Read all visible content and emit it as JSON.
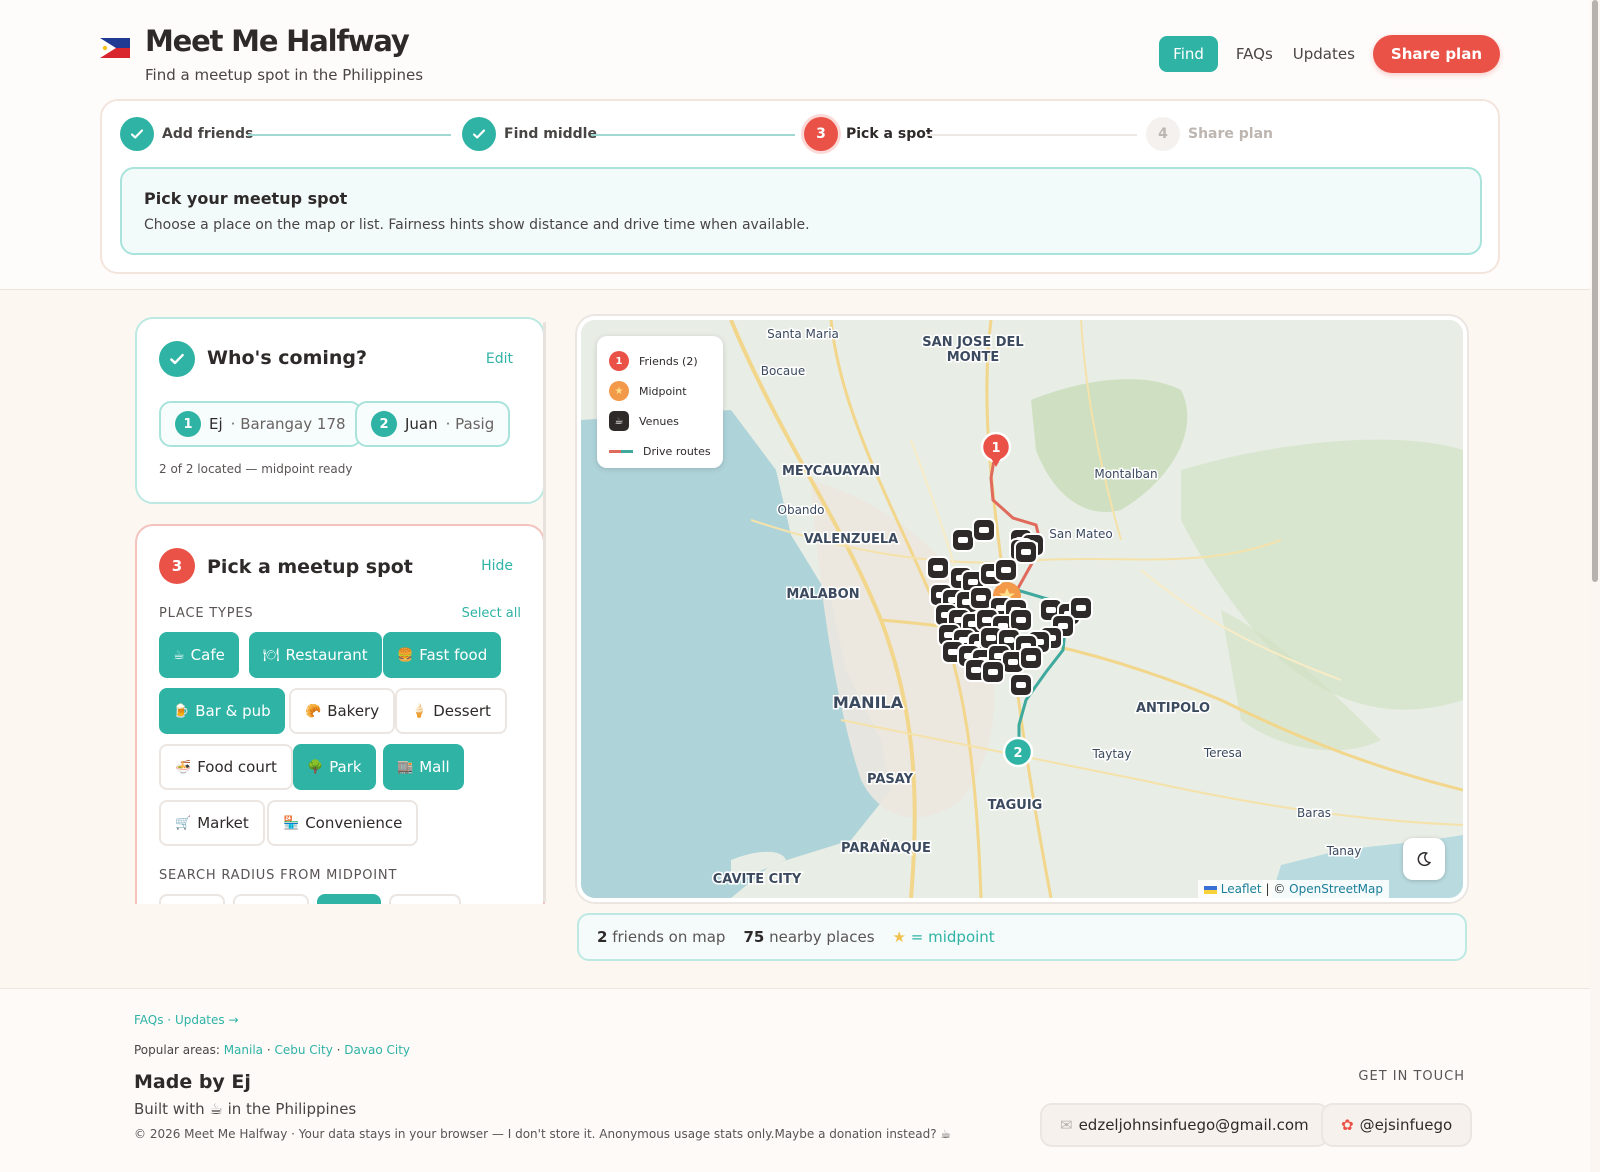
{
  "header": {
    "title": "Meet Me Halfway",
    "subtitle": "Find a meetup spot in the Philippines",
    "nav": {
      "find": "Find",
      "faqs": "FAQs",
      "updates": "Updates",
      "share": "Share plan"
    }
  },
  "stepper": {
    "steps": [
      {
        "num": "1",
        "label": "Add friends",
        "state": "done"
      },
      {
        "num": "2",
        "label": "Find middle",
        "state": "done"
      },
      {
        "num": "3",
        "label": "Pick a spot",
        "state": "active"
      },
      {
        "num": "4",
        "label": "Share plan",
        "state": "todo"
      }
    ],
    "info_title": "Pick your meetup spot",
    "info_text": "Choose a place on the map or list. Fairness hints show distance and drive time when available."
  },
  "who": {
    "title": "Who's coming?",
    "edit": "Edit",
    "friends": [
      {
        "num": "1",
        "name": "Ej",
        "place": "· Barangay 178"
      },
      {
        "num": "2",
        "name": "Juan",
        "place": "· Pasig"
      }
    ],
    "status": "2 of 2 located — midpoint ready"
  },
  "pick": {
    "num": "3",
    "title": "Pick a meetup spot",
    "hide": "Hide",
    "types_label": "PLACE TYPES",
    "select_all": "Select all",
    "types": [
      {
        "label": "Cafe",
        "icon": "☕",
        "on": true
      },
      {
        "label": "Restaurant",
        "icon": "🍽",
        "on": true
      },
      {
        "label": "Fast food",
        "icon": "🍔",
        "on": true
      },
      {
        "label": "Bar & pub",
        "icon": "🍺",
        "on": true
      },
      {
        "label": "Bakery",
        "icon": "🥐",
        "on": false
      },
      {
        "label": "Dessert",
        "icon": "🍦",
        "on": false
      },
      {
        "label": "Food court",
        "icon": "🍜",
        "on": false
      },
      {
        "label": "Park",
        "icon": "🌳",
        "on": true
      },
      {
        "label": "Mall",
        "icon": "🏬",
        "on": true
      },
      {
        "label": "Market",
        "icon": "🛒",
        "on": false
      },
      {
        "label": "Convenience",
        "icon": "🏪",
        "on": false
      }
    ],
    "radius_label": "SEARCH RADIUS FROM MIDPOINT"
  },
  "map": {
    "legend": {
      "friends": "Friends (2)",
      "midpoint": "Midpoint",
      "venues": "Venues",
      "routes": "Drive routes"
    },
    "labels": [
      {
        "text": "Santa Maria"
      },
      {
        "text": "SAN JOSE DEL"
      },
      {
        "text": "MONTE"
      },
      {
        "text": "Bocaue"
      },
      {
        "text": "MEYCAUAYAN"
      },
      {
        "text": "Montalban"
      },
      {
        "text": "Obando"
      },
      {
        "text": "VALENZUELA"
      },
      {
        "text": "San Mateo"
      },
      {
        "text": "MALABON"
      },
      {
        "text": "MANILA"
      },
      {
        "text": "ANTIPOLO"
      },
      {
        "text": "Taytay"
      },
      {
        "text": "Teresa"
      },
      {
        "text": "PASAY"
      },
      {
        "text": "TAGUIG"
      },
      {
        "text": "Baras"
      },
      {
        "text": "PARAÑAQUE"
      },
      {
        "text": "Tanay"
      },
      {
        "text": "CAVITE CITY"
      }
    ],
    "pin1": "1",
    "pin2": "2",
    "attrib_leaflet": "Leaflet",
    "attrib_sep": "| ©",
    "attrib_osm": "OpenStreetMap"
  },
  "stats": {
    "friends_count": "2",
    "friends_label": "friends on map",
    "places_count": "75",
    "places_label": "nearby places",
    "midpoint_label": "= midpoint"
  },
  "footer": {
    "links": "FAQs · Updates →",
    "popular_label": "Popular areas:",
    "popular": [
      "Manila",
      "Cebu City",
      "Davao City"
    ],
    "made_by": "Made by Ej",
    "built_with": "Built with ☕ in the Philippines",
    "copyright": "© 2026 Meet Me Halfway · Your data stays in your browser — I don't store it. Anonymous usage stats only.Maybe a donation instead? ☕",
    "get_in_touch": "GET IN TOUCH",
    "email": "edzeljohnsinfuego@gmail.com",
    "social": "@ejsinfuego"
  },
  "colors": {
    "teal": "#2fb3a5",
    "coral": "#ea5248",
    "ink": "#2f2a2a"
  }
}
